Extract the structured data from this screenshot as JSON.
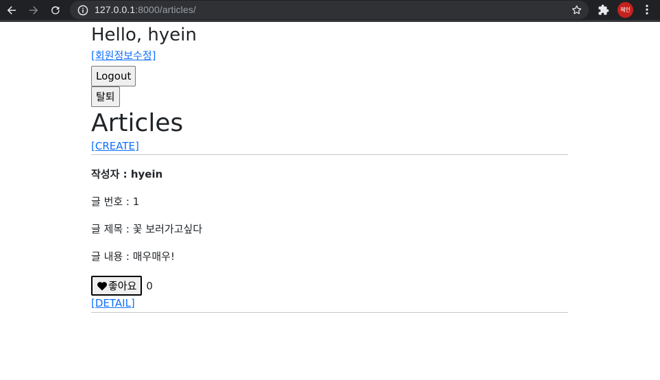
{
  "browser": {
    "url_host": "127.0.0.1",
    "url_rest": ":8000/articles/",
    "profile_label": "혜인",
    "icons": {
      "back": "arrow-left-icon",
      "forward": "arrow-right-icon",
      "reload": "reload-icon",
      "info": "info-icon",
      "bookmark": "star-icon",
      "extensions": "puzzle-icon",
      "menu": "kebab-menu-icon"
    }
  },
  "user": {
    "greeting": "Hello, hyein",
    "edit_profile_link": "[회원정보수정]",
    "logout_button": "Logout",
    "withdraw_button": "탈퇴"
  },
  "page": {
    "title": "Articles",
    "create_link": "[CREATE]"
  },
  "articles": [
    {
      "author_line": "작성자 : hyein",
      "number_line": "글 번호 : 1",
      "subject_line": "글 제목 : 꽃 보러가고싶다",
      "content_line": "글 내용 : 매우매우!",
      "like_label": "좋아요",
      "like_count": "0",
      "detail_link": "[DETAIL]"
    }
  ],
  "colors": {
    "chrome_bg": "#202124",
    "omnibox_bg": "#303134",
    "link": "#0d6efd",
    "text": "#212529",
    "avatar": "#c5221f"
  }
}
